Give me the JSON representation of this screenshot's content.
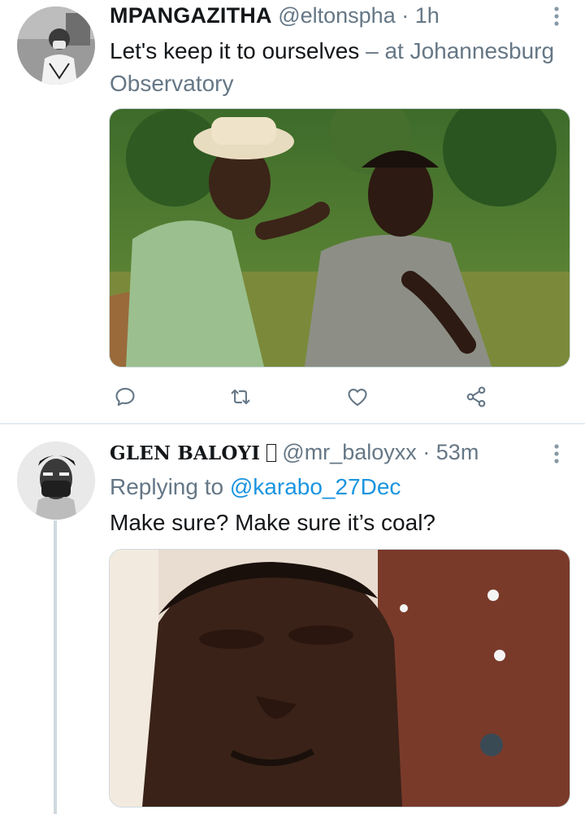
{
  "tweets": [
    {
      "display_name": "MPANGAZITHA",
      "handle": "@eltonspha",
      "separator": "·",
      "time": "1h",
      "text": "Let's keep it to ourselves",
      "place_separator": "–",
      "place_prefix": "at",
      "place": "Johannesburg Observatory",
      "avatar_icon": "avatar-photo-icon",
      "media_alt": "Two men outdoors, one pointing"
    },
    {
      "display_name": "GLEN BALOYI",
      "name_badge": "",
      "handle": "@mr_baloyxx",
      "separator": "·",
      "time": "53m",
      "reply_prefix": "Replying to",
      "reply_to": "@karabo_27Dec",
      "text": "Make sure? Make sure it’s coal?",
      "avatar_icon": "avatar-photo-icon",
      "media_alt": "Close-up of man with a worried expression"
    }
  ],
  "actions": [
    "reply-icon",
    "retweet-icon",
    "like-icon",
    "share-icon"
  ],
  "colors": {
    "secondary_text": "#657786",
    "link": "#1b95e0",
    "icon": "#657786",
    "divider": "#e6ecf0"
  }
}
